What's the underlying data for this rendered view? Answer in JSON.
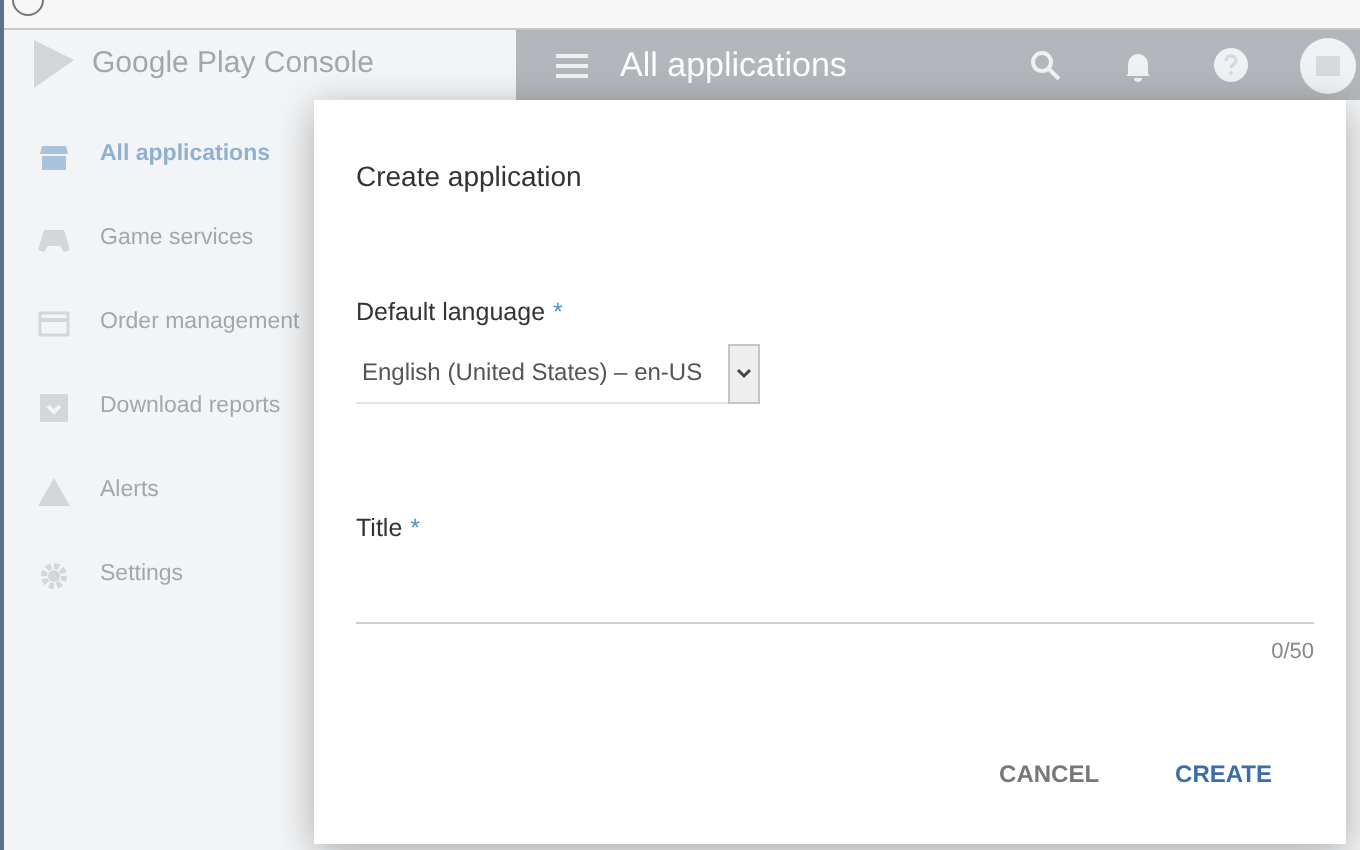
{
  "sidebar": {
    "brand": "Google Play Console",
    "items": [
      {
        "label": "All applications",
        "selected": true
      },
      {
        "label": "Game services",
        "selected": false
      },
      {
        "label": "Order management",
        "selected": false
      },
      {
        "label": "Download reports",
        "selected": false
      },
      {
        "label": "Alerts",
        "selected": false
      },
      {
        "label": "Settings",
        "selected": false
      }
    ]
  },
  "app_bar": {
    "title": "All applications"
  },
  "dialog": {
    "title": "Create application",
    "language": {
      "label": "Default language",
      "required_mark": "*",
      "value": "English (United States) – en-US"
    },
    "title_field": {
      "label": "Title",
      "required_mark": "*",
      "counter": "0/50"
    },
    "buttons": [
      {
        "label": "CANCEL",
        "kind": "secondary"
      },
      {
        "label": "CREATE",
        "kind": "primary"
      }
    ]
  }
}
